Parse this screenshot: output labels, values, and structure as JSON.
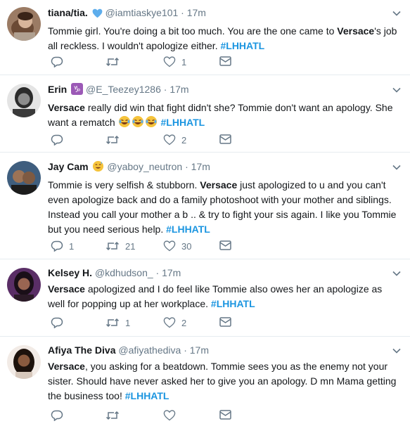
{
  "tweets": [
    {
      "name": "tiana/tia.",
      "name_badge": "blue-heart",
      "handle": "@iamtiaskye101",
      "time": "17m",
      "text_parts": [
        {
          "t": "Tommie girl. You're doing a bit too much. You are the one came to ",
          "s": "plain"
        },
        {
          "t": "Versace",
          "s": "bold"
        },
        {
          "t": "'s job all reckless. I wouldn't apologize either. ",
          "s": "plain"
        },
        {
          "t": "#LHHATL",
          "s": "hashtag"
        }
      ],
      "reply_count": "",
      "retweet_count": "",
      "like_count": "1",
      "avatar": {
        "bg": "#8a6a58",
        "fg": "#d9b7a0",
        "hair": "#3a2418"
      }
    },
    {
      "name": "Erin",
      "name_badge": "capricorn",
      "handle": "@E_Teezey1286",
      "time": "17m",
      "text_parts": [
        {
          "t": "Versace",
          "s": "bold"
        },
        {
          "t": " really did win that fight didn't she? Tommie don't want an apology. She want a rematch ",
          "s": "plain"
        },
        {
          "t": "emoji3",
          "s": "emoji"
        },
        {
          "t": " ",
          "s": "plain"
        },
        {
          "t": "#LHHATL",
          "s": "hashtag"
        }
      ],
      "reply_count": "",
      "retweet_count": "",
      "like_count": "2",
      "avatar": {
        "bg": "#d8d8d8",
        "fg": "#6b6b6b",
        "hair": "#2a2a2a"
      }
    },
    {
      "name": "Jay Cam",
      "name_badge": "sweat-smile",
      "handle": "@yaboy_neutron",
      "time": "17m",
      "text_parts": [
        {
          "t": "Tommie is very selfish & stubborn. ",
          "s": "plain"
        },
        {
          "t": "Versace",
          "s": "bold"
        },
        {
          "t": " just apologized to u and you can't even apologize back and do a family photoshoot with your mother and siblings. Instead you call your mother a b",
          "s": "plain"
        },
        {
          "t": "  ..  & try to fight your sis again. I like you Tommie but you need serious help. ",
          "s": "plain"
        },
        {
          "t": "#LHHATL",
          "s": "hashtag"
        }
      ],
      "reply_count": "1",
      "retweet_count": "21",
      "like_count": "30",
      "avatar": {
        "bg": "#3d5b7a",
        "fg": "#a57a5c",
        "hair": "#1b1b1b"
      }
    },
    {
      "name": "Kelsey H.",
      "name_badge": "",
      "handle": "@kdhudson_",
      "time": "17m",
      "text_parts": [
        {
          "t": "Versace",
          "s": "bold"
        },
        {
          "t": " apologized and I do feel like Tommie also owes her an apologize as well for popping up at her workplace. ",
          "s": "plain"
        },
        {
          "t": "#LHHATL",
          "s": "hashtag"
        }
      ],
      "reply_count": "",
      "retweet_count": "1",
      "like_count": "2",
      "avatar": {
        "bg": "#4a2a55",
        "fg": "#8a5a4a",
        "hair": "#1a0f18"
      }
    },
    {
      "name": "Afiya The Diva",
      "name_badge": "",
      "handle": "@afiyathediva",
      "time": "17m",
      "text_parts": [
        {
          "t": "Versace",
          "s": "bold"
        },
        {
          "t": ", you asking for a beatdown. Tommie sees you as the enemy not your sister. Should have never asked her to give you an apology. D  mn Mama getting the business too! ",
          "s": "plain"
        },
        {
          "t": "#LHHATL",
          "s": "hashtag"
        }
      ],
      "reply_count": "",
      "retweet_count": "",
      "like_count": "",
      "avatar": {
        "bg": "#f0e6df",
        "fg": "#7a4e36",
        "hair": "#1d120c"
      }
    }
  ],
  "colors": {
    "text": "#14171a",
    "muted": "#657786",
    "hashtag": "#1b95e0",
    "divider": "#e6ecf0"
  }
}
